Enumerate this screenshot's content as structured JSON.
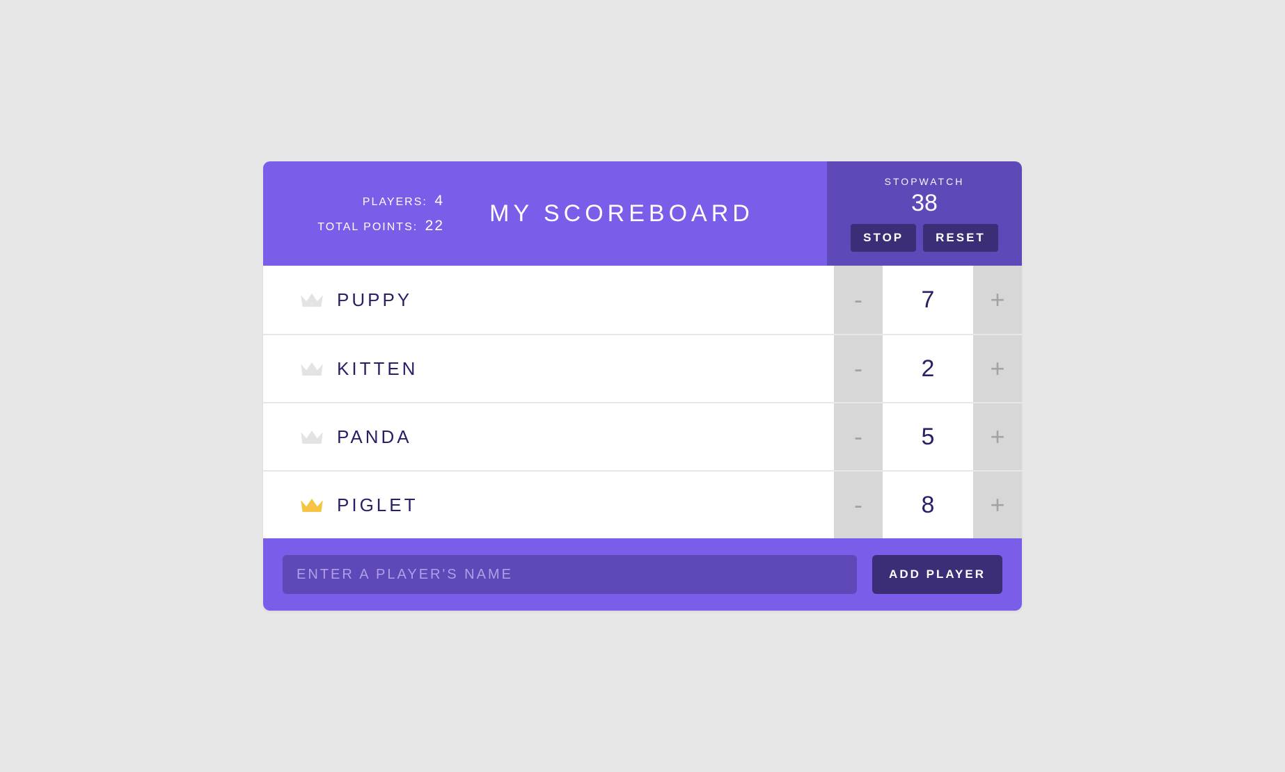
{
  "header": {
    "players_label": "PLAYERS:",
    "players_count": "4",
    "points_label": "TOTAL POINTS:",
    "points_total": "22",
    "title": "MY SCOREBOARD"
  },
  "stopwatch": {
    "label": "STOPWATCH",
    "value": "38",
    "stop_label": "STOP",
    "reset_label": "RESET"
  },
  "players": [
    {
      "name": "PUPPY",
      "score": "7",
      "leader": false
    },
    {
      "name": "KITTEN",
      "score": "2",
      "leader": false
    },
    {
      "name": "PANDA",
      "score": "5",
      "leader": false
    },
    {
      "name": "PIGLET",
      "score": "8",
      "leader": true
    }
  ],
  "controls": {
    "minus": "-",
    "plus": "+"
  },
  "footer": {
    "placeholder": "ENTER A PLAYER'S NAME",
    "add_label": "ADD PLAYER"
  },
  "colors": {
    "accent": "#7a5de8",
    "accent_dark": "#5f48b7",
    "btn_dark": "#3b2e77",
    "leader_crown": "#f6c343",
    "crown_inactive": "#e3e3e3",
    "text_dark": "#2b1e66"
  }
}
